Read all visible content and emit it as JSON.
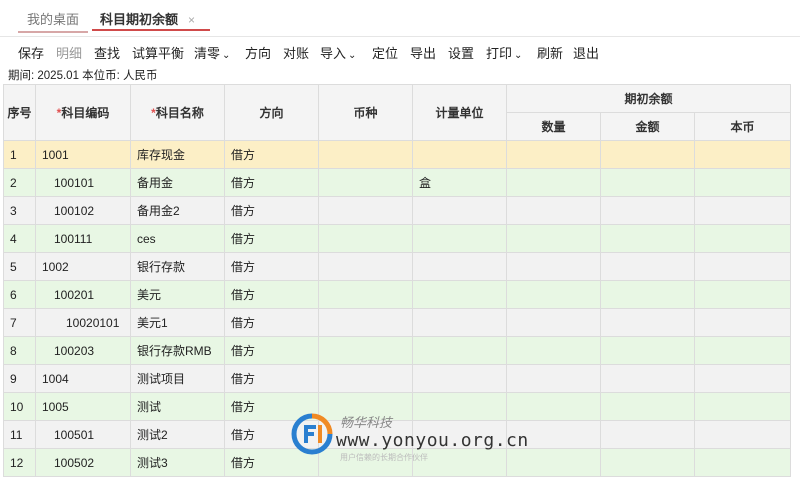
{
  "tabs": [
    {
      "label": "我的桌面"
    },
    {
      "label": "科目期初余额",
      "close": "×"
    }
  ],
  "toolbar": [
    {
      "label": "保存",
      "disabled": false
    },
    {
      "label": "明细",
      "disabled": true
    },
    {
      "label": "查找",
      "disabled": false
    },
    {
      "label": "试算平衡",
      "disabled": false
    },
    {
      "label": "清零",
      "disabled": false,
      "dropdown": true
    },
    {
      "label": "方向",
      "disabled": false
    },
    {
      "label": "对账",
      "disabled": false
    },
    {
      "label": "导入",
      "disabled": false,
      "dropdown": true
    },
    {
      "label": "定位",
      "disabled": false
    },
    {
      "label": "导出",
      "disabled": false
    },
    {
      "label": "设置",
      "disabled": false
    },
    {
      "label": "打印",
      "disabled": false,
      "dropdown": true
    },
    {
      "label": "刷新",
      "disabled": false
    },
    {
      "label": "退出",
      "disabled": false
    }
  ],
  "info": {
    "text": "期间: 2025.01   本位币: 人民币"
  },
  "table": {
    "headers": {
      "seq": "序号",
      "code_req": "*",
      "code": "科目编码",
      "name_req": "*",
      "name": "科目名称",
      "direction": "方向",
      "currency": "币种",
      "unit": "计量单位",
      "group": "期初余额",
      "qty": "数量",
      "amount": "金额",
      "local": "本币"
    },
    "rows": [
      {
        "seq": "1",
        "code": "1001",
        "name": "库存现金",
        "direction": "借方",
        "currency": "",
        "unit": "",
        "indent": 0,
        "selected": true
      },
      {
        "seq": "2",
        "code": "100101",
        "name": "备用金",
        "direction": "借方",
        "currency": "",
        "unit": "盒",
        "indent": 1
      },
      {
        "seq": "3",
        "code": "100102",
        "name": "备用金2",
        "direction": "借方",
        "currency": "",
        "unit": "",
        "indent": 1
      },
      {
        "seq": "4",
        "code": "100111",
        "name": "ces",
        "direction": "借方",
        "currency": "",
        "unit": "",
        "indent": 1
      },
      {
        "seq": "5",
        "code": "1002",
        "name": "银行存款",
        "direction": "借方",
        "currency": "",
        "unit": "",
        "indent": 0
      },
      {
        "seq": "6",
        "code": "100201",
        "name": "美元",
        "direction": "借方",
        "currency": "",
        "unit": "",
        "indent": 1
      },
      {
        "seq": "7",
        "code": "10020101",
        "name": "美元1",
        "direction": "借方",
        "currency": "",
        "unit": "",
        "indent": 2
      },
      {
        "seq": "8",
        "code": "100203",
        "name": "银行存款RMB",
        "direction": "借方",
        "currency": "",
        "unit": "",
        "indent": 1
      },
      {
        "seq": "9",
        "code": "1004",
        "name": "测试项目",
        "direction": "借方",
        "currency": "",
        "unit": "",
        "indent": 0
      },
      {
        "seq": "10",
        "code": "1005",
        "name": "测试",
        "direction": "借方",
        "currency": "",
        "unit": "",
        "indent": 0
      },
      {
        "seq": "11",
        "code": "100501",
        "name": "测试2",
        "direction": "借方",
        "currency": "",
        "unit": "",
        "indent": 1
      },
      {
        "seq": "12",
        "code": "100502",
        "name": "测试3",
        "direction": "借方",
        "currency": "",
        "unit": "",
        "indent": 1
      }
    ]
  },
  "watermark": {
    "name": "畅华科技",
    "url": "www.yonyou.org.cn",
    "sub": "用户信赖的长期合作伙伴",
    "colors": {
      "blue": "#2a7fd0",
      "orange": "#f08a24"
    }
  },
  "colors": {
    "tab_accent": "#d04a4a",
    "row_green": "#e8f7e4",
    "row_gray": "#f2f2f2",
    "row_selected": "#fcefc6"
  }
}
